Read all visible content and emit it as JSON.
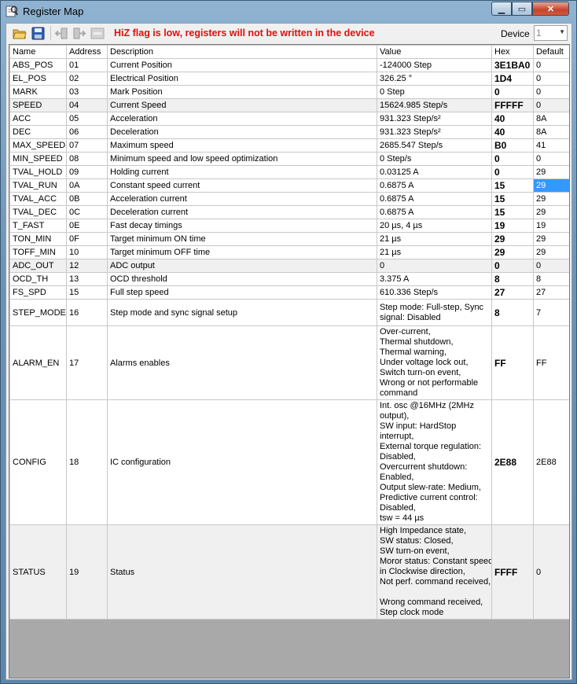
{
  "window": {
    "title": "Register Map"
  },
  "toolbar": {
    "hiz_message": "HiZ flag is low, registers will not be written in the device",
    "device_label": "Device",
    "device_value": "1",
    "icons": [
      "open-folder-icon",
      "save-icon",
      "read-registers-icon",
      "write-registers-icon",
      "reset-icon"
    ]
  },
  "table": {
    "headers": [
      "Name",
      "Address",
      "Description",
      "Value",
      "Hex",
      "Default"
    ],
    "rows": [
      {
        "name": "ABS_POS",
        "address": "01",
        "description": "Current Position",
        "value": [
          "-124000 Step"
        ],
        "hex": "3E1BA0",
        "default": "0"
      },
      {
        "name": "EL_POS",
        "address": "02",
        "description": "Electrical Position",
        "value": [
          "326.25 °"
        ],
        "hex": "1D4",
        "default": "0"
      },
      {
        "name": "MARK",
        "address": "03",
        "description": "Mark Position",
        "value": [
          "0 Step"
        ],
        "hex": "0",
        "default": "0"
      },
      {
        "name": "SPEED",
        "address": "04",
        "description": "Current Speed",
        "value": [
          "15624.985 Step/s"
        ],
        "hex": "FFFFF",
        "default": "0"
      },
      {
        "name": "ACC",
        "address": "05",
        "description": "Acceleration",
        "value": [
          "931.323 Step/s²"
        ],
        "hex": "40",
        "default": "8A"
      },
      {
        "name": "DEC",
        "address": "06",
        "description": "Deceleration",
        "value": [
          "931.323 Step/s²"
        ],
        "hex": "40",
        "default": "8A"
      },
      {
        "name": "MAX_SPEED",
        "address": "07",
        "description": "Maximum speed",
        "value": [
          "2685.547 Step/s"
        ],
        "hex": "B0",
        "default": "41"
      },
      {
        "name": "MIN_SPEED",
        "address": "08",
        "description": "Minimum speed and low speed optimization",
        "value": [
          "0 Step/s"
        ],
        "hex": "0",
        "default": "0"
      },
      {
        "name": "TVAL_HOLD",
        "address": "09",
        "description": "Holding current",
        "value": [
          "0.03125 A"
        ],
        "hex": "0",
        "default": "29"
      },
      {
        "name": "TVAL_RUN",
        "address": "0A",
        "description": "Constant speed current",
        "value": [
          "0.6875 A"
        ],
        "hex": "15",
        "default": "29"
      },
      {
        "name": "TVAL_ACC",
        "address": "0B",
        "description": "Acceleration current",
        "value": [
          "0.6875 A"
        ],
        "hex": "15",
        "default": "29"
      },
      {
        "name": "TVAL_DEC",
        "address": "0C",
        "description": "Deceleration current",
        "value": [
          "0.6875 A"
        ],
        "hex": "15",
        "default": "29"
      },
      {
        "name": "T_FAST",
        "address": "0E",
        "description": "Fast decay timings",
        "value": [
          "20 µs, 4 µs"
        ],
        "hex": "19",
        "default": "19"
      },
      {
        "name": "TON_MIN",
        "address": "0F",
        "description": "Target minimum ON time",
        "value": [
          "21 µs"
        ],
        "hex": "29",
        "default": "29"
      },
      {
        "name": "TOFF_MIN",
        "address": "10",
        "description": "Target minimum OFF time",
        "value": [
          "21 µs"
        ],
        "hex": "29",
        "default": "29"
      },
      {
        "name": "ADC_OUT",
        "address": "12",
        "description": "ADC output",
        "value": [
          "0"
        ],
        "hex": "0",
        "default": "0"
      },
      {
        "name": "OCD_TH",
        "address": "13",
        "description": "OCD threshold",
        "value": [
          "3.375 A"
        ],
        "hex": "8",
        "default": "8"
      },
      {
        "name": "FS_SPD",
        "address": "15",
        "description": "Full step speed",
        "value": [
          "610.336 Step/s"
        ],
        "hex": "27",
        "default": "27"
      },
      {
        "name": "STEP_MODE",
        "address": "16",
        "description": "Step mode and sync signal setup",
        "value": [
          "Step mode: Full-step, Sync",
          "signal: Disabled"
        ],
        "hex": "8",
        "default": "7"
      },
      {
        "name": "ALARM_EN",
        "address": "17",
        "description": "Alarms enables",
        "value": [
          "Over-current,",
          "Thermal shutdown,",
          "Thermal warning,",
          "Under voltage lock out,",
          "Switch turn-on event,",
          "Wrong or not performable",
          "command"
        ],
        "hex": "FF",
        "default": "FF"
      },
      {
        "name": "CONFIG",
        "address": "18",
        "description": "IC configuration",
        "value": [
          "Int. osc @16MHz (2MHz",
          "output),",
          "SW input: HardStop",
          "interrupt,",
          "External torque regulation:",
          "Disabled,",
          "Overcurrent shutdown:",
          "Enabled,",
          "Output slew-rate: Medium,",
          "Predictive current control:",
          "Disabled,",
          "tsw = 44 µs"
        ],
        "hex": "2E88",
        "default": "2E88"
      },
      {
        "name": "STATUS",
        "address": "19",
        "description": "Status",
        "value": [
          "High Impedance state,",
          "SW status: Closed,",
          "SW turn-on event,",
          "Moror status: Constant speed",
          "in Clockwise direction,",
          "Not perf. command received,",
          "",
          "Wrong command received,",
          "Step clock mode"
        ],
        "hex": "FFFF",
        "default": "0"
      }
    ]
  }
}
